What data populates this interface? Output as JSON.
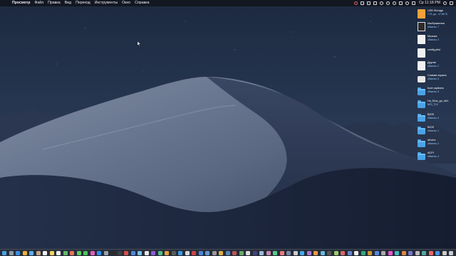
{
  "menubar": {
    "apple_glyph": "",
    "app_name": "Просмотр",
    "menus": [
      "Файл",
      "Правка",
      "Вид",
      "Переход",
      "Инструменты",
      "Окно",
      "Справка"
    ],
    "clock": "Ср 11:18 PM"
  },
  "desktop": {
    "items": [
      {
        "name": "USB Storage",
        "sub": "7 ГБ, до... 47,98 ГБ",
        "kind": "usb-drive-icon"
      },
      {
        "name": "Изображения",
        "sub": "объекты: 7",
        "kind": "image-folder-icon"
      },
      {
        "name": "Музыка",
        "sub": "объекты: 3",
        "kind": "music-file-icon"
      },
      {
        "name": "config.plist",
        "sub": "",
        "kind": "plist-file-icon"
      },
      {
        "name": "Другие",
        "sub": "объекты: 2",
        "kind": "apple-file-icon"
      },
      {
        "name": "Снимки экрана",
        "sub": "объекты: 5",
        "kind": "disk-icon"
      },
      {
        "name": "boot capitans",
        "sub": "объекты: 5",
        "kind": "folder-icon"
      },
      {
        "name": "Ho_Elos_go_rdt1",
        "sub": "NES_TOC",
        "kind": "folder-icon"
      },
      {
        "name": "BIOS",
        "sub": "объекты: 4",
        "kind": "folder-icon"
      },
      {
        "name": "BIOS",
        "sub": "объекты: 1",
        "kind": "folder-icon"
      },
      {
        "name": "drivers",
        "sub": "объекты: 2",
        "kind": "folder-icon"
      },
      {
        "name": "ACPI",
        "sub": "объекты: 4",
        "kind": "folder-icon"
      }
    ]
  },
  "colors": {
    "folder": "#4aa3e6",
    "menubar_bg": "#12161e",
    "sky_top": "#1c2940",
    "dune": "#6c7a93"
  },
  "dock": {
    "icons": [
      {
        "name": "finder-icon",
        "color": "#4aa3e6"
      },
      {
        "name": "launchpad-icon",
        "color": "#8e9aa8"
      },
      {
        "name": "safari-icon",
        "color": "#3a8fe0"
      },
      {
        "name": "chrome-icon",
        "color": "#e9b43a"
      },
      {
        "name": "mail-icon",
        "color": "#5ab0f0"
      },
      {
        "name": "contacts-icon",
        "color": "#c7a882"
      },
      {
        "name": "calendar-icon",
        "color": "#f2f2f2"
      },
      {
        "name": "notes-icon",
        "color": "#f4d35e"
      },
      {
        "name": "reminders-icon",
        "color": "#f2f2f2"
      },
      {
        "name": "maps-icon",
        "color": "#68b86a"
      },
      {
        "name": "photos-icon",
        "color": "#e5745a"
      },
      {
        "name": "messages-icon",
        "color": "#5ccf5c"
      },
      {
        "name": "facetime-icon",
        "color": "#4cc55a"
      },
      {
        "name": "itunes-icon",
        "color": "#e45dbb"
      },
      {
        "name": "appstore-icon",
        "color": "#2f8ff0"
      },
      {
        "name": "preferences-icon",
        "color": "#9aa0a8"
      },
      {
        "name": "terminal-icon",
        "color": "#2b2b2b"
      },
      {
        "name": "activity-icon",
        "color": "#3f3f3f"
      },
      {
        "name": "app-icon",
        "color": "#d94c4c"
      },
      {
        "name": "app-icon",
        "color": "#4c8ad9"
      },
      {
        "name": "app-icon",
        "color": "#7bc0e8"
      },
      {
        "name": "app-icon",
        "color": "#e8e8e8"
      },
      {
        "name": "app-icon",
        "color": "#8e5bd6"
      },
      {
        "name": "app-icon",
        "color": "#4fbf8c"
      },
      {
        "name": "app-icon",
        "color": "#e6a03c"
      },
      {
        "name": "app-icon",
        "color": "#5a5a5a"
      },
      {
        "name": "app-icon",
        "color": "#3c9be6"
      },
      {
        "name": "app-icon",
        "color": "#d8d8d8"
      },
      {
        "name": "app-icon",
        "color": "#c44"
      },
      {
        "name": "app-icon",
        "color": "#4a86d8"
      },
      {
        "name": "app-icon",
        "color": "#69c"
      },
      {
        "name": "app-icon",
        "color": "#999"
      },
      {
        "name": "app-icon",
        "color": "#e0b040"
      },
      {
        "name": "app-icon",
        "color": "#58b"
      },
      {
        "name": "app-icon",
        "color": "#b55"
      },
      {
        "name": "app-icon",
        "color": "#6a6"
      },
      {
        "name": "app-icon",
        "color": "#ddd"
      },
      {
        "name": "app-icon",
        "color": "#447"
      },
      {
        "name": "app-icon",
        "color": "#9bd"
      },
      {
        "name": "app-icon",
        "color": "#c8a"
      },
      {
        "name": "app-icon",
        "color": "#5c8"
      },
      {
        "name": "app-icon",
        "color": "#e77"
      },
      {
        "name": "app-icon",
        "color": "#78a"
      },
      {
        "name": "app-icon",
        "color": "#ccc"
      },
      {
        "name": "app-icon",
        "color": "#4ae"
      },
      {
        "name": "app-icon",
        "color": "#a7c"
      },
      {
        "name": "app-icon",
        "color": "#e94"
      },
      {
        "name": "app-icon",
        "color": "#6bd"
      },
      {
        "name": "app-icon",
        "color": "#555"
      },
      {
        "name": "app-icon",
        "color": "#9c6"
      },
      {
        "name": "app-icon",
        "color": "#d66"
      },
      {
        "name": "app-icon",
        "color": "#68c"
      },
      {
        "name": "app-icon",
        "color": "#eee"
      },
      {
        "name": "app-icon",
        "color": "#3a7"
      },
      {
        "name": "app-icon",
        "color": "#c93"
      },
      {
        "name": "app-icon",
        "color": "#58d"
      },
      {
        "name": "app-icon",
        "color": "#aaa"
      },
      {
        "name": "app-icon",
        "color": "#e5c"
      },
      {
        "name": "app-icon",
        "color": "#4bb"
      },
      {
        "name": "app-icon",
        "color": "#d84"
      },
      {
        "name": "app-icon",
        "color": "#77c"
      },
      {
        "name": "app-icon",
        "color": "#bbb"
      },
      {
        "name": "app-icon",
        "color": "#5a9"
      },
      {
        "name": "app-icon",
        "color": "#e66"
      },
      {
        "name": "app-icon",
        "color": "#49d"
      },
      {
        "name": "app-icon",
        "color": "#ccc"
      },
      {
        "name": "trash-icon",
        "color": "#c9ccd2"
      }
    ]
  }
}
